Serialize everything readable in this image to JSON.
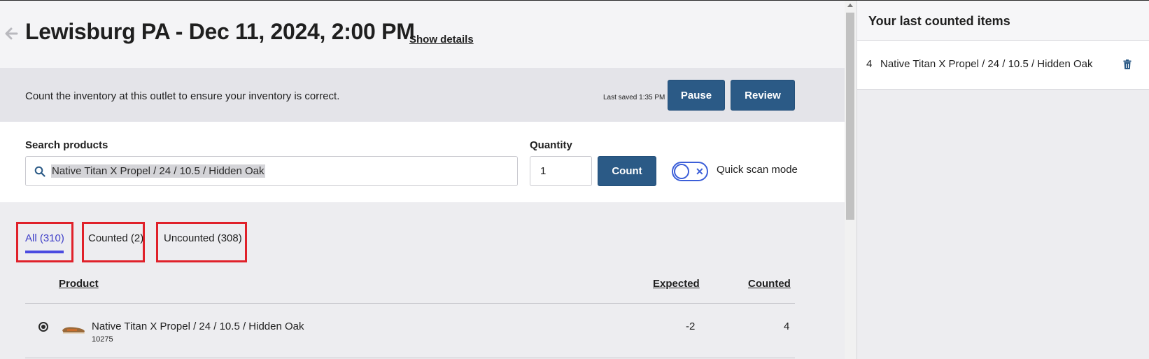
{
  "header": {
    "title": "Lewisburg PA - Dec 11, 2024, 2:00 PM",
    "show_details": "Show details",
    "back_icon": "arrow-left-icon"
  },
  "banner": {
    "text": "Count the inventory at this outlet to ensure your inventory is correct.",
    "last_saved": "Last saved 1:35 PM",
    "pause_label": "Pause",
    "review_label": "Review"
  },
  "search": {
    "label": "Search products",
    "value": "Native Titan X Propel / 24 / 10.5 / Hidden Oak",
    "icon": "search-icon",
    "quantity_label": "Quantity",
    "quantity_value": "1",
    "count_label": "Count",
    "quick_scan_label": "Quick scan mode",
    "quick_scan_enabled": false
  },
  "tabs": [
    {
      "label": "All (310)",
      "active": true
    },
    {
      "label": "Counted (2)",
      "active": false
    },
    {
      "label": "Uncounted (308)",
      "active": false
    }
  ],
  "table": {
    "headers": {
      "product": "Product",
      "expected": "Expected",
      "counted": "Counted"
    },
    "rows": [
      {
        "name": "Native Titan X Propel / 24 / 10.5 / Hidden Oak",
        "sku": "10275",
        "expected": "-2",
        "counted": "4"
      }
    ]
  },
  "right_panel": {
    "title": "Your last counted items",
    "items": [
      {
        "qty": "4",
        "name": "Native Titan X Propel / 24 / 10.5 / Hidden Oak",
        "icon": "trash-icon"
      }
    ]
  },
  "colors": {
    "primary_button": "#2b5a86",
    "active_tab": "#3f3fc8",
    "highlight_box": "#e0212a",
    "toggle": "#3c5fd8"
  }
}
